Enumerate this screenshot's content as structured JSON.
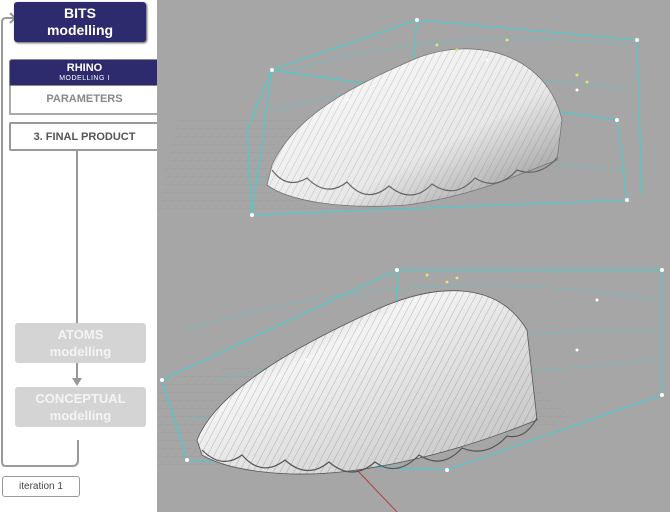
{
  "sidebar": {
    "bits": {
      "line1": "BITS",
      "line2": "modelling"
    },
    "rhino": {
      "title": "RHINO",
      "subtitle": "MODELLING I"
    },
    "parameters": "PARAMETERS",
    "final_product": "3. FINAL PRODUCT",
    "atoms": {
      "line1": "ATOMS",
      "line2": "modelling"
    },
    "conceptual": {
      "line1": "CONCEPTUAL",
      "line2": "modelling"
    },
    "iteration": "iteration  1"
  },
  "viewport": {
    "background": "#a6a6a6",
    "cage_color": "#3fd0d0",
    "surface_color": "#f2f2f2",
    "views": [
      "top-3d-view",
      "bottom-3d-view"
    ]
  }
}
